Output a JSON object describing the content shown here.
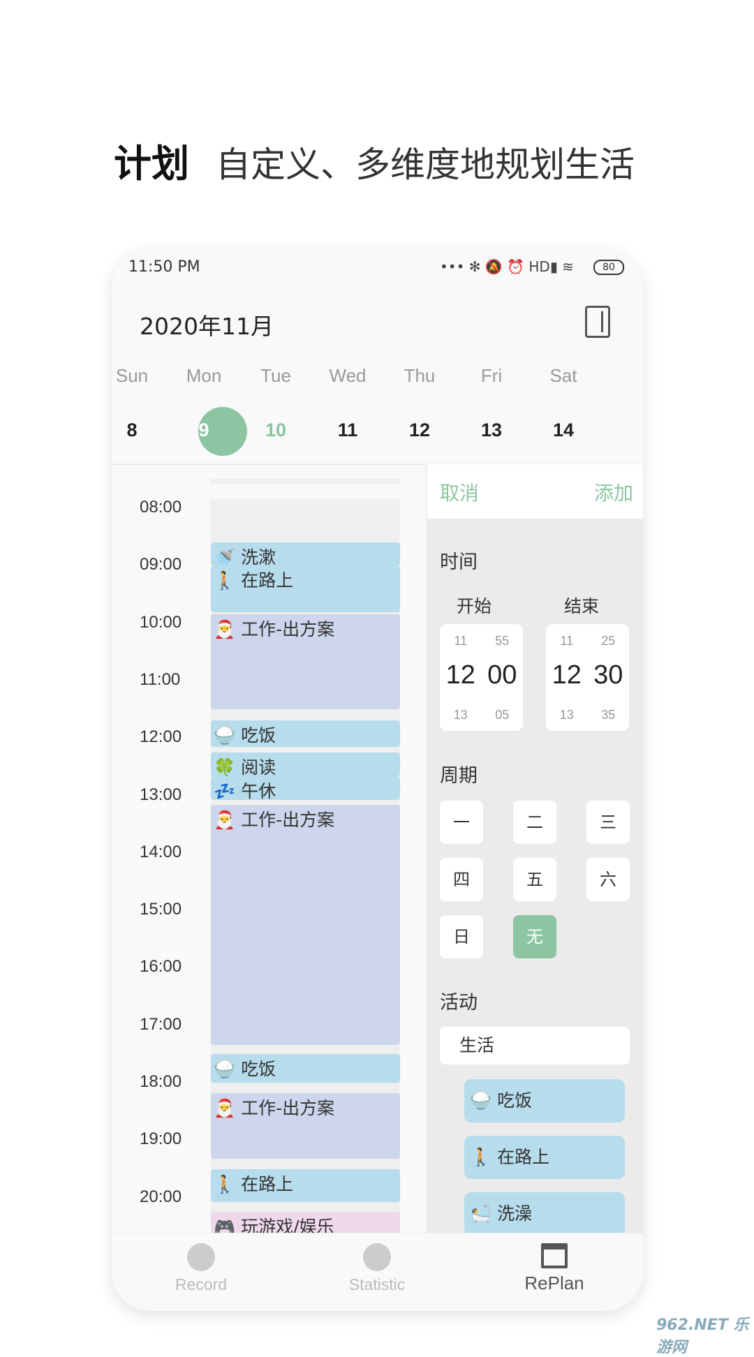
{
  "headline": {
    "title": "计划",
    "subtitle": "自定义、多维度地规划生活"
  },
  "status_bar": {
    "time": "11:50 PM",
    "icons": "••• ✻ 🔕 ⏰ HD▮ ≋",
    "battery": "80"
  },
  "calendar": {
    "month": "2020年11月",
    "notebook_icon": "notebook-icon",
    "weekdays": [
      "Sun",
      "Mon",
      "Tue",
      "Wed",
      "Thu",
      "Fri",
      "Sat"
    ],
    "dates": [
      "8",
      "9",
      "10",
      "11",
      "12",
      "13",
      "14"
    ],
    "selected": "9",
    "today_highlight": "10",
    "accent": "#8dc5a2"
  },
  "timeline": {
    "hours": [
      "08:00",
      "09:00",
      "10:00",
      "11:00",
      "12:00",
      "13:00",
      "14:00",
      "15:00",
      "16:00",
      "17:00",
      "18:00",
      "19:00",
      "20:00"
    ],
    "events": [
      {
        "icon": "🚿",
        "label": "洗漱"
      },
      {
        "icon": "🚶",
        "label": "在路上"
      },
      {
        "icon": "🎅",
        "label": "工作-出方案"
      },
      {
        "icon": "🍚",
        "label": "吃饭"
      },
      {
        "icon": "🍀",
        "label": "阅读"
      },
      {
        "icon": "💤",
        "label": "午休"
      },
      {
        "icon": "🎅",
        "label": "工作-出方案"
      },
      {
        "icon": "🍚",
        "label": "吃饭"
      },
      {
        "icon": "🎅",
        "label": "工作-出方案"
      },
      {
        "icon": "🚶",
        "label": "在路上"
      },
      {
        "icon": "🎮",
        "label": "玩游戏/娱乐"
      }
    ]
  },
  "panel": {
    "cancel": "取消",
    "add": "添加",
    "time_label": "时间",
    "start_label": "开始",
    "end_label": "结束",
    "start": {
      "h_prev": "11",
      "h": "12",
      "h_next": "13",
      "m_prev": "55",
      "m": "00",
      "m_next": "05"
    },
    "end": {
      "h_prev": "11",
      "h": "12",
      "h_next": "13",
      "m_prev": "25",
      "m": "30",
      "m_next": "35"
    },
    "cycle_label": "周期",
    "cycle": [
      "一",
      "二",
      "三",
      "四",
      "五",
      "六",
      "日",
      "无"
    ],
    "cycle_selected": "无",
    "activity_label": "活动",
    "category": "生活",
    "activities": [
      {
        "icon": "🍚",
        "label": "吃饭"
      },
      {
        "icon": "🚶",
        "label": "在路上"
      },
      {
        "icon": "🛀",
        "label": "洗澡"
      }
    ]
  },
  "nav": [
    {
      "label": "Record",
      "active": false
    },
    {
      "label": "Statistic",
      "active": false
    },
    {
      "label": "RePlan",
      "active": true
    }
  ],
  "watermark": "962.NET 乐游网"
}
